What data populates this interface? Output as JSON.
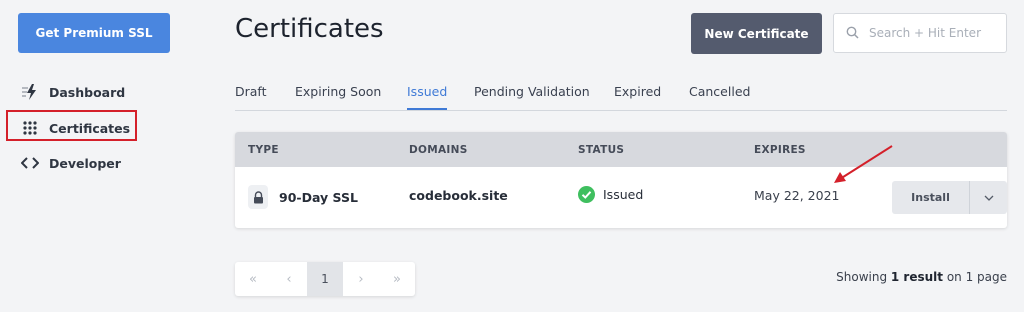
{
  "sidebar": {
    "premium_button": "Get Premium SSL",
    "items": [
      {
        "label": "Dashboard",
        "icon": "bolt-icon"
      },
      {
        "label": "Certificates",
        "icon": "grid-dots-icon"
      },
      {
        "label": "Developer",
        "icon": "code-brackets-icon"
      }
    ]
  },
  "header": {
    "title": "Certificates",
    "new_button": "New Certificate",
    "search_placeholder": "Search + Hit Enter"
  },
  "tabs": [
    "Draft",
    "Expiring Soon",
    "Issued",
    "Pending Validation",
    "Expired",
    "Cancelled"
  ],
  "active_tab": "Issued",
  "table": {
    "columns": [
      "TYPE",
      "DOMAINS",
      "STATUS",
      "EXPIRES"
    ],
    "rows": [
      {
        "type": "90-Day SSL",
        "domain": "codebook.site",
        "status": "Issued",
        "expires": "May 22, 2021",
        "action": "Install"
      }
    ]
  },
  "pagination": {
    "first": "«",
    "prev": "‹",
    "current": "1",
    "next": "›",
    "last": "»"
  },
  "summary": {
    "prefix": "Showing ",
    "count": "1 result",
    "suffix": " on 1 page"
  },
  "colors": {
    "accent": "#3f7ad6",
    "premium": "#4a86df",
    "new_button": "#545b6e",
    "status_ok": "#3fbf5f",
    "annotation": "#d4202a"
  }
}
